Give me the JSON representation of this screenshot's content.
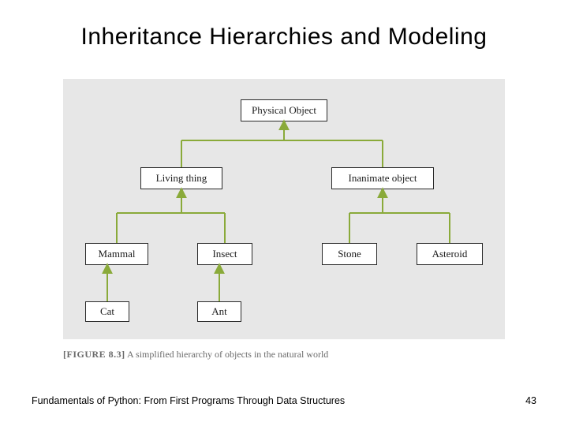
{
  "title": "Inheritance Hierarchies and Modeling",
  "diagram": {
    "root": "Physical Object",
    "level2": {
      "left": "Living thing",
      "right": "Inanimate object"
    },
    "level3": {
      "mammal": "Mammal",
      "insect": "Insect",
      "stone": "Stone",
      "asteroid": "Asteroid"
    },
    "level4": {
      "cat": "Cat",
      "ant": "Ant"
    }
  },
  "caption": {
    "label": "[FIGURE 8.3]",
    "text": "A simplified hierarchy of objects in the natural world"
  },
  "footer": {
    "left": "Fundamentals of Python: From First Programs Through Data Structures",
    "right": "43"
  }
}
